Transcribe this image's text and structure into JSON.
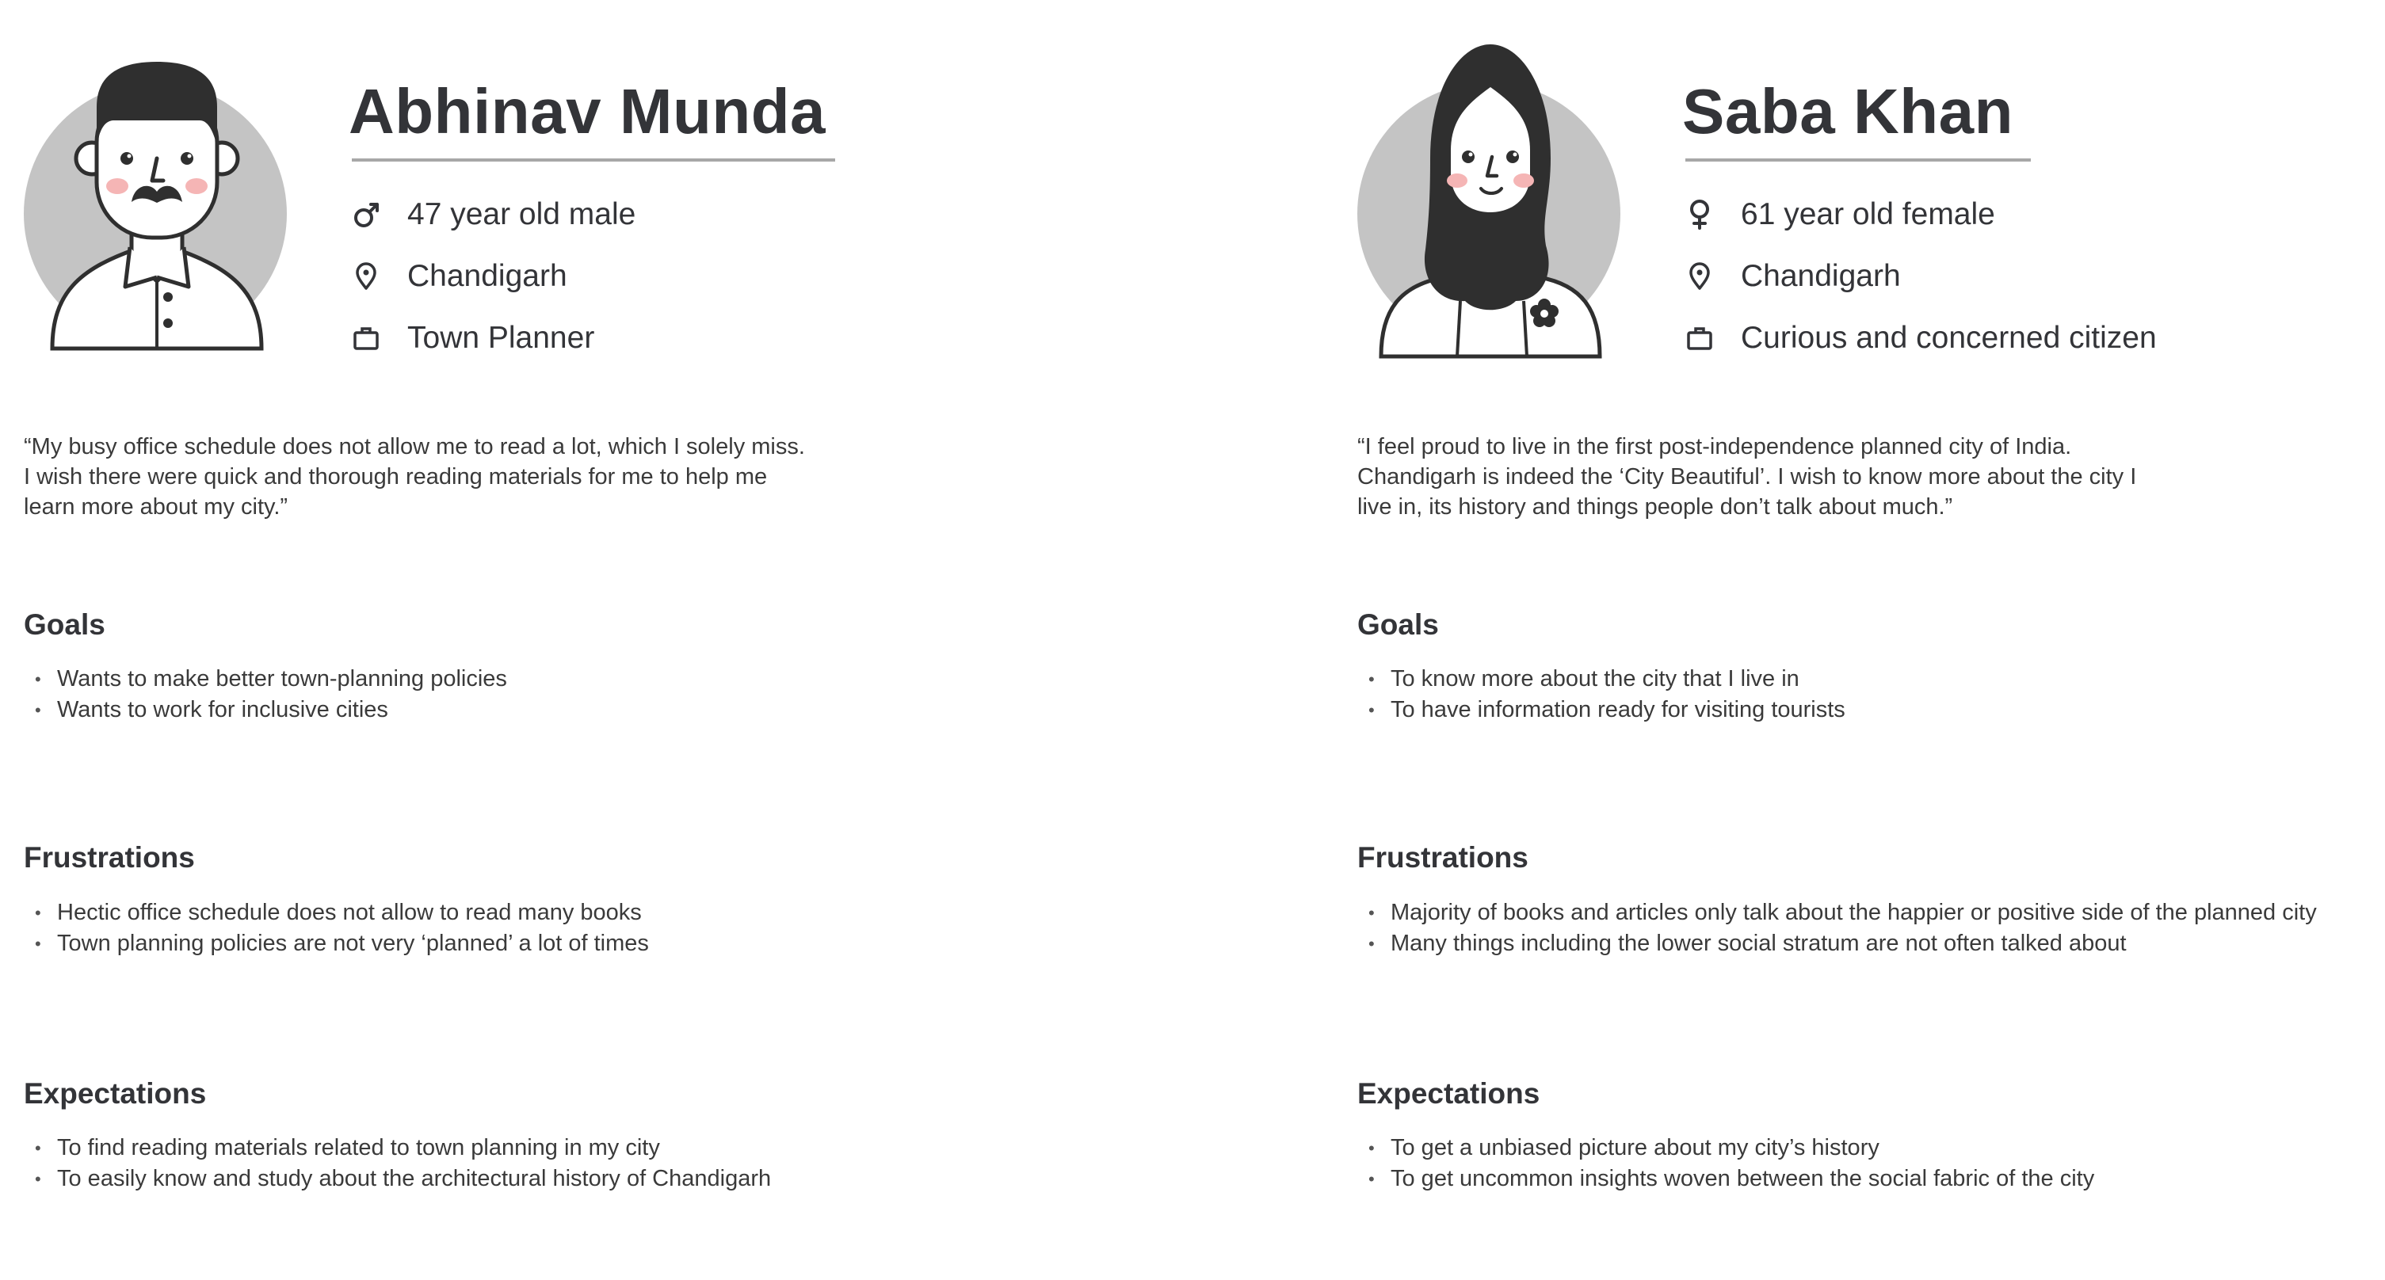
{
  "personas": [
    {
      "name": "Abhinav Munda",
      "age_gender": "47 year old male",
      "location": "Chandigarh",
      "occupation": "Town Planner",
      "quote_lines": [
        "“My busy office schedule does not allow me to read a lot, which I solely miss.",
        "I wish there were quick and thorough reading materials for me to help me",
        "learn more about my city.”"
      ],
      "goals_title": "Goals",
      "goals": [
        "Wants to make better town-planning policies",
        "Wants to work for inclusive cities"
      ],
      "frustrations_title": "Frustrations",
      "frustrations": [
        "Hectic office schedule does not allow to read many books",
        "Town planning policies are not very ‘planned’ a lot of times"
      ],
      "expectations_title": "Expectations",
      "expectations": [
        "To find reading materials related to town planning in my city",
        "To easily know and study about the architectural history of Chandigarh"
      ],
      "gender_icon": "male-symbol-icon",
      "avatar_icon": "man-with-mustache-avatar"
    },
    {
      "name": "Saba Khan",
      "age_gender": "61 year old female",
      "location": "Chandigarh",
      "occupation": "Curious and concerned citizen",
      "quote_lines": [
        "“I feel proud to live in the first post-independence planned city of India.",
        "Chandigarh is indeed the ‘City Beautiful’. I wish to know more about the city I",
        "live in, its history and things people don’t talk about much.”"
      ],
      "goals_title": "Goals",
      "goals": [
        "To know more about the city that I live in",
        "To have information ready for visiting tourists"
      ],
      "frustrations_title": "Frustrations",
      "frustrations": [
        "Majority of books and articles only talk about the happier or positive side of the planned city",
        "Many things including the lower social stratum are not often talked about"
      ],
      "expectations_title": "Expectations",
      "expectations": [
        "To get a unbiased picture about my city’s history",
        "To get uncommon insights woven between the social fabric of the city"
      ],
      "gender_icon": "female-symbol-icon",
      "avatar_icon": "woman-in-hijab-avatar"
    }
  ],
  "colors": {
    "text_dark": "#333438",
    "avatar_circle": "#c4c4c4",
    "avatar_hair": "#2f2f2f",
    "blush": "#f5b5b5",
    "rule": "#a8a8a8"
  },
  "icons": {
    "location": "map-pin-icon",
    "occupation": "briefcase-icon"
  }
}
